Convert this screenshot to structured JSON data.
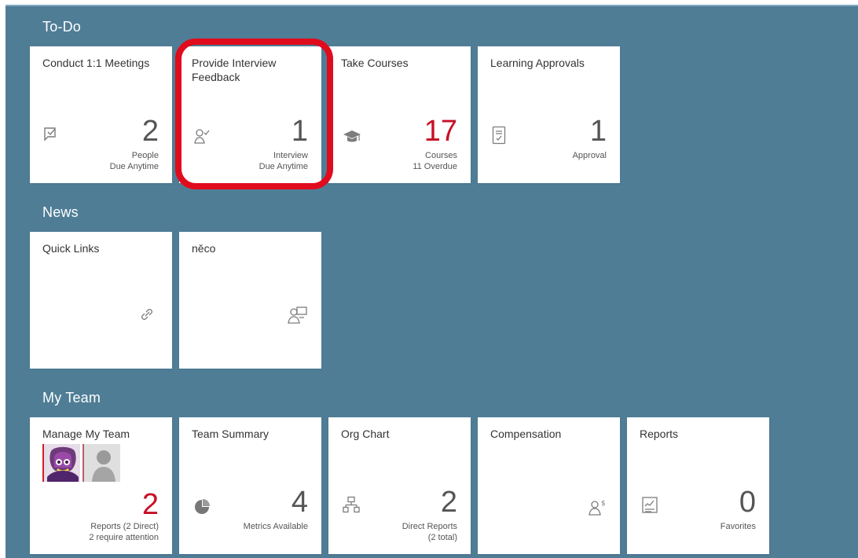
{
  "sections": {
    "todo": "To-Do",
    "news": "News",
    "myteam": "My Team"
  },
  "todo": {
    "meetings": {
      "title": "Conduct 1:1 Meetings",
      "count": "2",
      "sub": "People\nDue Anytime",
      "icon": "checklist-icon"
    },
    "interview": {
      "title": "Provide Interview Feedback",
      "count": "1",
      "sub": "Interview\nDue Anytime",
      "icon": "person-check-icon"
    },
    "courses": {
      "title": "Take Courses",
      "count": "17",
      "sub": "Courses\n11 Overdue",
      "icon": "graduation-cap-icon"
    },
    "approvals": {
      "title": "Learning Approvals",
      "count": "1",
      "sub": "Approval",
      "icon": "document-check-icon"
    }
  },
  "news": {
    "quicklinks": {
      "title": "Quick Links",
      "icon": "link-icon"
    },
    "neco": {
      "title": "něco",
      "icon": "person-board-icon"
    }
  },
  "team": {
    "manage": {
      "title": "Manage My Team",
      "count": "2",
      "sub": "Reports (2 Direct)\n2 require attention",
      "icons": [
        "team-avatar-purple",
        "team-avatar-grey"
      ]
    },
    "summary": {
      "title": "Team Summary",
      "count": "4",
      "sub": "Metrics Available",
      "icon": "pie-chart-icon"
    },
    "org": {
      "title": "Org Chart",
      "count": "2",
      "sub": "Direct Reports\n(2 total)",
      "icon": "org-chart-icon"
    },
    "compensation": {
      "title": "Compensation",
      "icon": "person-dollar-icon"
    },
    "reports": {
      "title": "Reports",
      "count": "0",
      "sub": "Favorites",
      "icon": "report-chart-icon"
    }
  },
  "colors": {
    "background": "#4f7d96",
    "tile": "#ffffff",
    "accent_red": "#c80f25",
    "highlight_circle": "#e00b1c"
  }
}
